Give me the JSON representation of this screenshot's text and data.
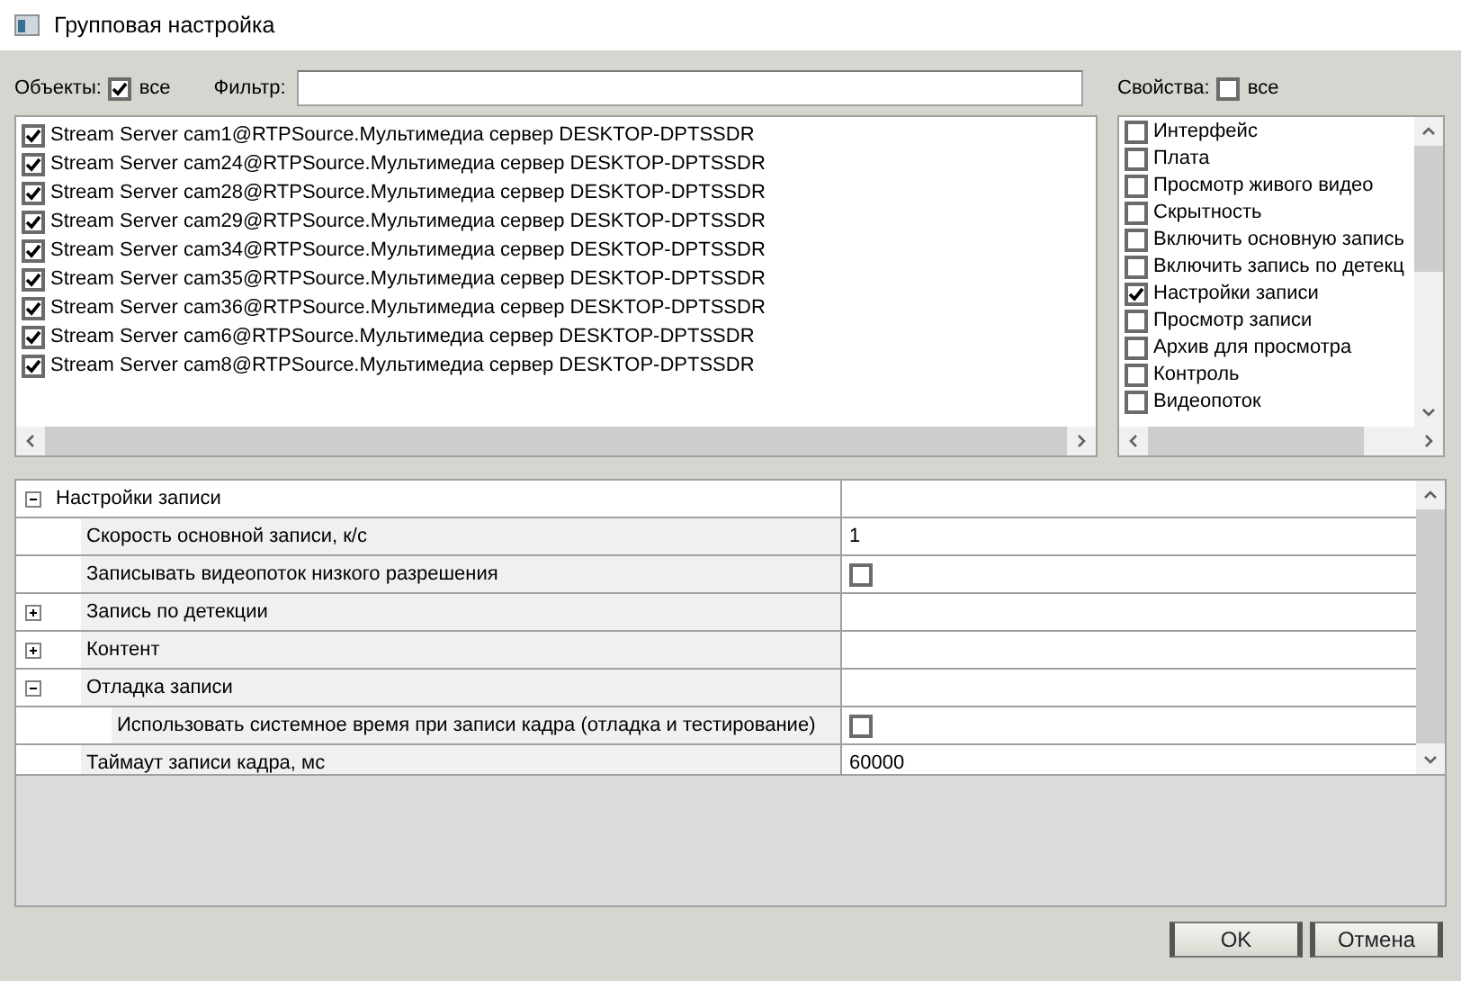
{
  "window": {
    "title": "Групповая настройка"
  },
  "objects": {
    "label": "Объекты:",
    "all_label": "все",
    "all_checked": true,
    "items": [
      {
        "label": "Stream Server cam1@RTPSource.Мультимедиа сервер DESKTOP-DPTSSDR",
        "checked": true
      },
      {
        "label": "Stream Server cam24@RTPSource.Мультимедиа сервер DESKTOP-DPTSSDR",
        "checked": true
      },
      {
        "label": "Stream Server cam28@RTPSource.Мультимедиа сервер DESKTOP-DPTSSDR",
        "checked": true
      },
      {
        "label": "Stream Server cam29@RTPSource.Мультимедиа сервер DESKTOP-DPTSSDR",
        "checked": true
      },
      {
        "label": "Stream Server cam34@RTPSource.Мультимедиа сервер DESKTOP-DPTSSDR",
        "checked": true
      },
      {
        "label": "Stream Server cam35@RTPSource.Мультимедиа сервер DESKTOP-DPTSSDR",
        "checked": true
      },
      {
        "label": "Stream Server cam36@RTPSource.Мультимедиа сервер DESKTOP-DPTSSDR",
        "checked": true
      },
      {
        "label": "Stream Server cam6@RTPSource.Мультимедиа сервер DESKTOP-DPTSSDR",
        "checked": true
      },
      {
        "label": "Stream Server cam8@RTPSource.Мультимедиа сервер DESKTOP-DPTSSDR",
        "checked": true
      }
    ]
  },
  "filter": {
    "label": "Фильтр:"
  },
  "properties": {
    "label": "Свойства:",
    "all_label": "все",
    "all_checked": false,
    "items": [
      {
        "label": "Интерфейс",
        "checked": false
      },
      {
        "label": "Плата",
        "checked": false
      },
      {
        "label": "Просмотр живого видео",
        "checked": false
      },
      {
        "label": "Скрытность",
        "checked": false
      },
      {
        "label": "Включить основную запись",
        "checked": false
      },
      {
        "label": "Включить запись по детекц",
        "checked": false
      },
      {
        "label": "Настройки записи",
        "checked": true
      },
      {
        "label": "Просмотр записи",
        "checked": false
      },
      {
        "label": "Архив для просмотра",
        "checked": false
      },
      {
        "label": "Контроль",
        "checked": false
      },
      {
        "label": "Видеопоток",
        "checked": false
      }
    ]
  },
  "grid": {
    "rows": [
      {
        "name": "Настройки записи",
        "kind": "group",
        "expanded": true,
        "children": [
          {
            "name": "Скорость основной записи, к/с",
            "kind": "text",
            "value": "1"
          },
          {
            "name": "Записывать видеопоток низкого разрешения",
            "kind": "checkbox",
            "checked": false
          },
          {
            "name": "Запись по детекции",
            "kind": "group",
            "expanded": false
          },
          {
            "name": "Контент",
            "kind": "group",
            "expanded": false
          },
          {
            "name": "Отладка записи",
            "kind": "group",
            "expanded": true,
            "children": [
              {
                "name": "Использовать системное время при записи кадра (отладка и тестирование)",
                "kind": "checkbox",
                "checked": false
              }
            ]
          },
          {
            "name": "Таймаут записи кадра, мс",
            "kind": "text",
            "value": "60000"
          }
        ]
      }
    ]
  },
  "buttons": [
    {
      "label": "OK"
    },
    {
      "label": "Отмена"
    }
  ]
}
